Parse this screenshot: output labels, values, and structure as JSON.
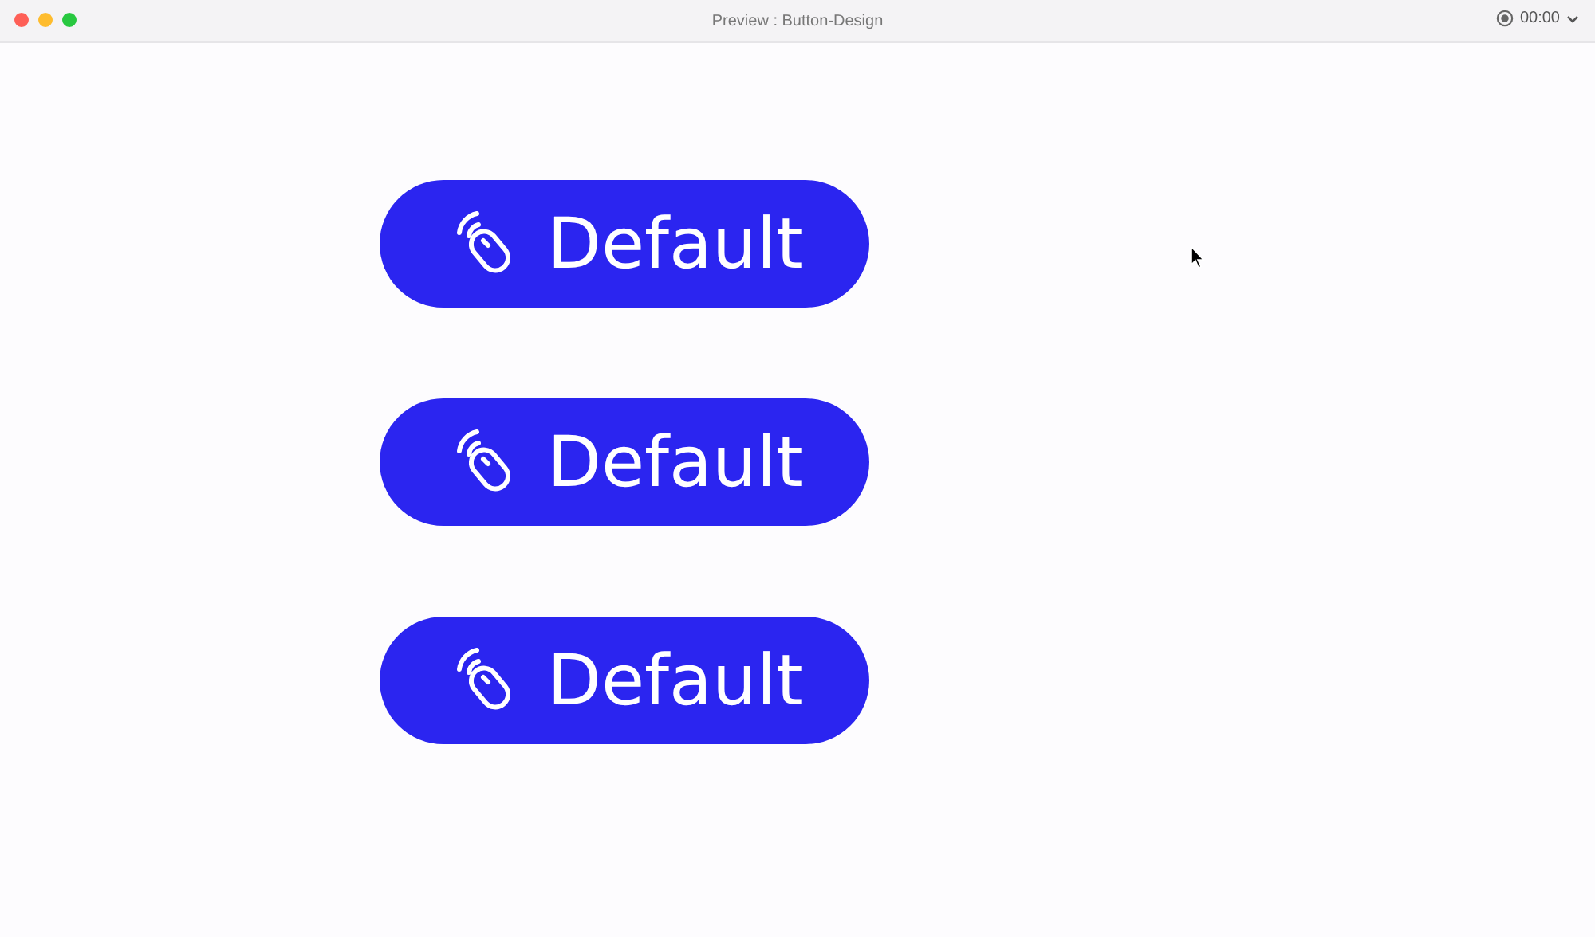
{
  "window": {
    "title": "Preview : Button-Design",
    "timer": "00:00"
  },
  "buttons": [
    {
      "label": "Default"
    },
    {
      "label": "Default"
    },
    {
      "label": "Default"
    }
  ]
}
